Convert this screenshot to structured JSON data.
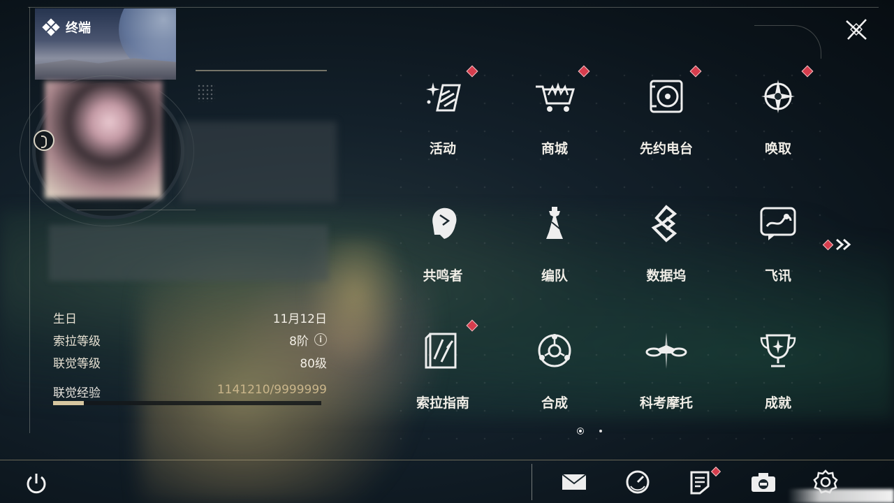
{
  "header": {
    "title": "终端"
  },
  "profile": {
    "info": [
      {
        "label": "生日",
        "value": "11月12日"
      },
      {
        "label": "索拉等级",
        "value": "8阶",
        "has_info_icon": true
      },
      {
        "label": "联觉等级",
        "value": "80级"
      }
    ],
    "exp": {
      "label": "联觉经验",
      "value": "1141210/9999999",
      "progress_fraction": 0.114
    }
  },
  "menu": [
    {
      "label": "活动",
      "icon": "activity-sparkle-icon",
      "badge": true
    },
    {
      "label": "商城",
      "icon": "shop-basket-icon",
      "badge": true
    },
    {
      "label": "先约电台",
      "icon": "radio-record-icon",
      "badge": true
    },
    {
      "label": "唤取",
      "icon": "convene-star-icon",
      "badge": true
    },
    {
      "label": "共鸣者",
      "icon": "resonator-head-icon",
      "badge": false
    },
    {
      "label": "编队",
      "icon": "team-chess-icon",
      "badge": false
    },
    {
      "label": "数据坞",
      "icon": "data-bank-icon",
      "badge": false
    },
    {
      "label": "飞讯",
      "icon": "message-chat-icon",
      "badge": false
    },
    {
      "label": "索拉指南",
      "icon": "guidebook-icon",
      "badge": true
    },
    {
      "label": "合成",
      "icon": "synthesis-orbit-icon",
      "badge": false
    },
    {
      "label": "科考摩托",
      "icon": "motorbike-icon",
      "badge": false
    },
    {
      "label": "成就",
      "icon": "achievement-trophy-icon",
      "badge": false
    }
  ],
  "pager": {
    "pages": 2,
    "current": 1
  },
  "bottom_bar": [
    {
      "name": "mail-icon",
      "badge": false
    },
    {
      "name": "clock-icon",
      "badge": false
    },
    {
      "name": "notice-board-icon",
      "badge": true
    },
    {
      "name": "camera-icon",
      "badge": false
    },
    {
      "name": "settings-gear-icon",
      "badge": false
    }
  ],
  "colors": {
    "accent_gold": "#d8c7a0",
    "badge_red": "#d63d4d",
    "text": "#f1eee7"
  }
}
